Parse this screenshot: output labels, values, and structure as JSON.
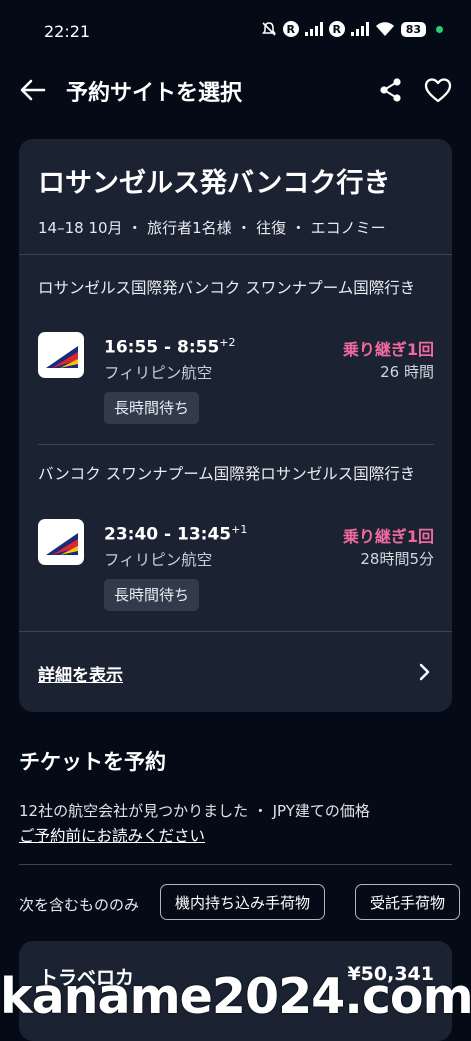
{
  "status_bar": {
    "time": "22:21",
    "battery": "83"
  },
  "header": {
    "title": "予約サイトを選択"
  },
  "trip": {
    "title": "ロサンゼルス発バンコク行き",
    "subtitle": "14–18 10月 ・ 旅行者1名様 ・ 往復 ・ エコノミー"
  },
  "legs": [
    {
      "route": "ロサンゼルス国際発バンコク スワンナプーム国際行き",
      "time_range": "16:55 - 8:55",
      "day_offset": "+2",
      "airline": "フィリピン航空",
      "stops": "乗り継ぎ1回",
      "duration": "26 時間",
      "tag": "長時間待ち"
    },
    {
      "route": "バンコク スワンナプーム国際発ロサンゼルス国際行き",
      "time_range": "23:40 - 13:45",
      "day_offset": "+1",
      "airline": "フィリピン航空",
      "stops": "乗り継ぎ1回",
      "duration": "28時間5分",
      "tag": "長時間待ち"
    }
  ],
  "details_link": "詳細を表示",
  "booking": {
    "title": "チケットを予約",
    "found_text": "12社の航空会社が見つかりました ・ JPY建ての価格",
    "read_link": "ご予約前にお読みください",
    "filter_label": "次を含むもののみ",
    "filters": [
      "機内持ち込み手荷物",
      "受託手荷物"
    ]
  },
  "provider": {
    "name": "トラベロカ",
    "price": "¥50,341"
  },
  "watermark": "kaname2024.com",
  "colors": {
    "background": "#050b16",
    "card": "#1b2333",
    "stops_pink": "#f06aa0"
  },
  "icons": [
    "back-arrow-icon",
    "share-icon",
    "heart-icon",
    "chevron-right-icon",
    "airline-logo-icon"
  ]
}
